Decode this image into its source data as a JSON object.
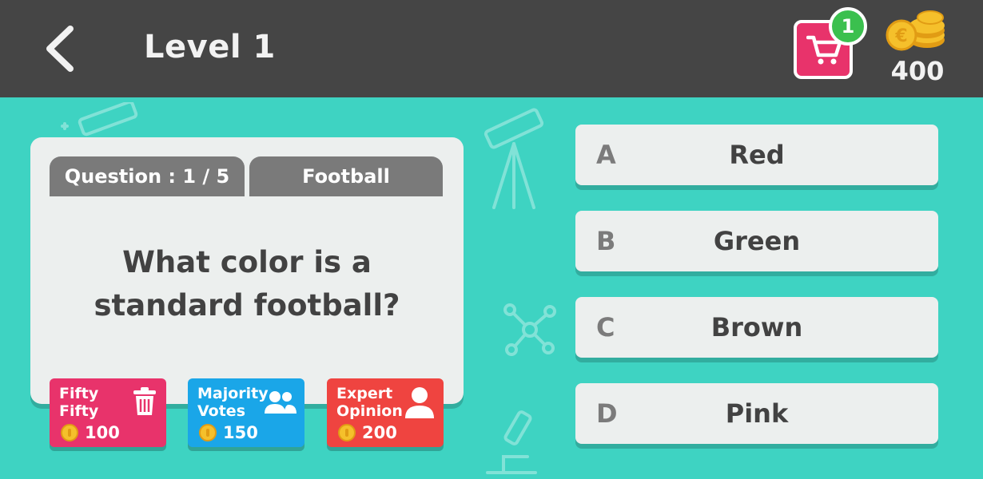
{
  "header": {
    "back_icon": "chevron-left-icon",
    "title": "Level 1",
    "shop_icon": "cart-icon",
    "shop_badge": "1",
    "coins_icon": "coin-stack-icon",
    "coins": "400"
  },
  "card": {
    "question_tab": "Question : 1 / 5",
    "category_tab": "Football",
    "question": "What color is a standard football?"
  },
  "lifelines": [
    {
      "label_line1": "Fifty",
      "label_line2": "Fifty",
      "cost": "100",
      "icon": "trash-icon",
      "color": "#e8336b"
    },
    {
      "label_line1": "Majority",
      "label_line2": "Votes",
      "cost": "150",
      "icon": "people-icon",
      "color": "#1aa6e8"
    },
    {
      "label_line1": "Expert",
      "label_line2": "Opinion",
      "cost": "200",
      "icon": "person-icon",
      "color": "#ef4440"
    }
  ],
  "answers": [
    {
      "letter": "A",
      "text": "Red"
    },
    {
      "letter": "B",
      "text": "Green"
    },
    {
      "letter": "C",
      "text": "Brown"
    },
    {
      "letter": "D",
      "text": "Pink"
    }
  ],
  "colors": {
    "background": "#3ed3c2",
    "topbar": "#454545",
    "card": "#ecefee",
    "tab": "#7a7a7a",
    "shop": "#e8336b",
    "badge": "#3bc04e"
  }
}
